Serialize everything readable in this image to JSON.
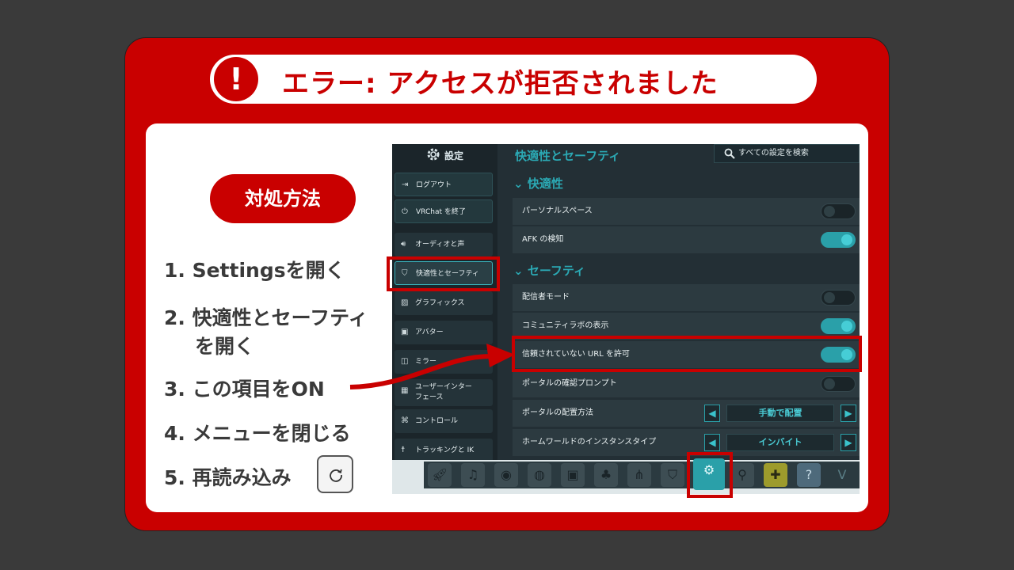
{
  "title": "エラー: アクセスが拒否されました",
  "alert_symbol": "!",
  "howto_label": "対処方法",
  "steps": {
    "s1": "1. Settingsを開く",
    "s2a": "2. 快適性とセーフティ",
    "s2b": "を開く",
    "s3": "3. この項目をON",
    "s4": "4. メニューを閉じる",
    "s5": "5. 再読み込み"
  },
  "vrchat": {
    "sidebar": {
      "title": "設定",
      "logout": "ログアウト",
      "quit": "VRChat を終了",
      "items": {
        "audio": "オーディオと声",
        "comfort": "快適性とセーフティ",
        "graphics": "グラフィックス",
        "avatar": "アバター",
        "mirror": "ミラー",
        "ui1": "ユーザーインター",
        "ui2": "フェース",
        "controls": "コントロール",
        "tracking": "トラッキングと IK"
      }
    },
    "header_title": "快適性とセーフティ",
    "search_label": "すべての設定を検索",
    "sections": {
      "comfort": "快適性",
      "safety": "セーフティ"
    },
    "rows": {
      "personal_space": "パーソナルスペース",
      "afk": "AFK の検知",
      "streamer": "配信者モード",
      "labs": "コミュニティラボの表示",
      "untrusted_url": "信頼されていない URL を許可",
      "portal_confirm": "ポータルの確認プロンプト",
      "portal_place": "ポータルの配置方法",
      "home_instance": "ホームワールドのインスタンスタイプ"
    },
    "toggles": {
      "personal_space": false,
      "afk": true,
      "streamer": false,
      "labs": true,
      "untrusted_url": true,
      "portal_confirm": false
    },
    "pickers": {
      "portal_place_value": "手動で配置",
      "home_instance_value": "インバイト"
    }
  },
  "colors": {
    "accent_red": "#c90000",
    "teal": "#2aa0a9"
  }
}
